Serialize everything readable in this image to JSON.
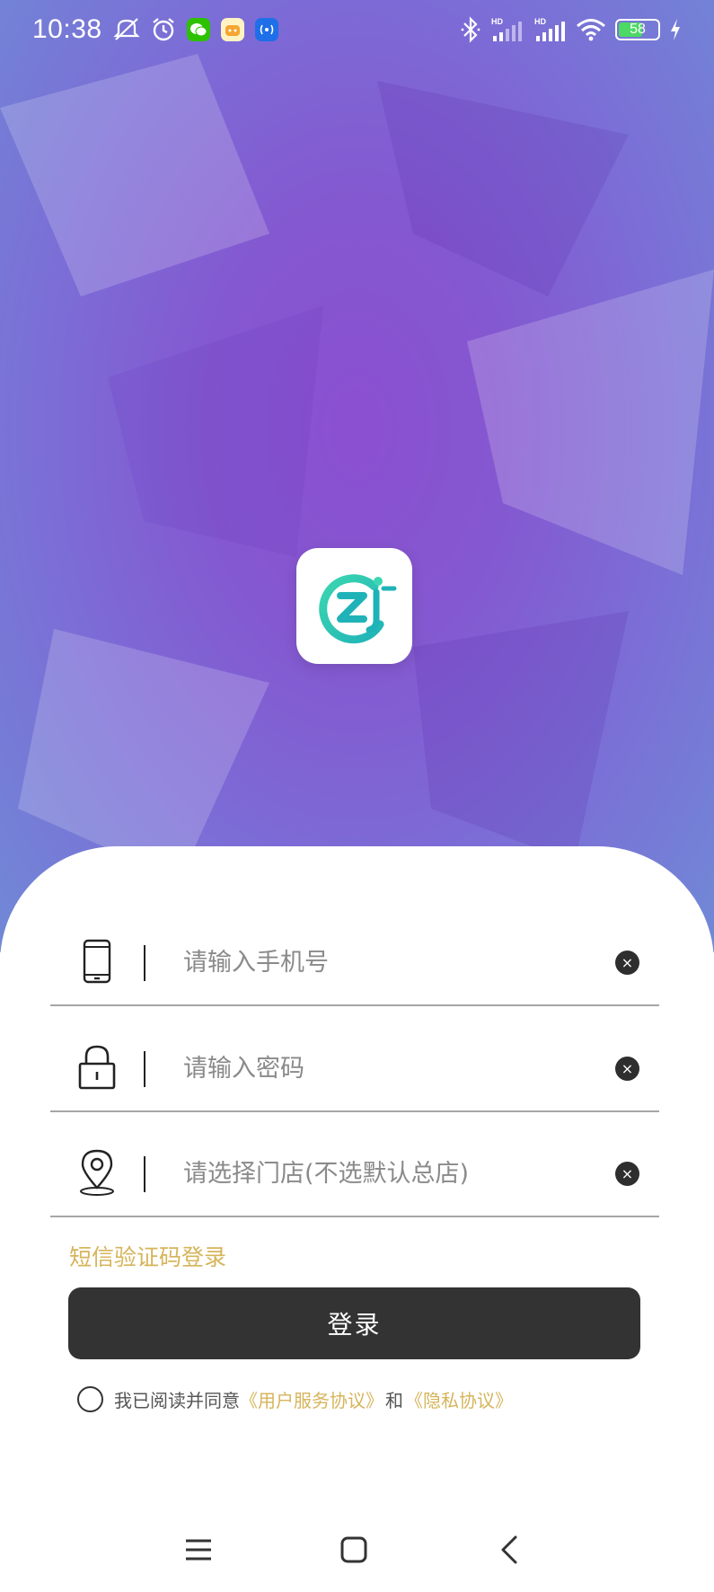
{
  "status_bar": {
    "time": "10:38",
    "battery": "58",
    "left_icons": [
      "mute-icon",
      "alarm-icon",
      "wechat-icon",
      "app-icon",
      "cast-icon"
    ],
    "right_icons": [
      "bluetooth-icon",
      "signal-hd-icon",
      "signal-hd-icon",
      "wifi-icon",
      "battery-icon",
      "charging-icon"
    ]
  },
  "logo": {
    "text": "zj",
    "alt": "app-logo"
  },
  "form": {
    "phone": {
      "placeholder": "请输入手机号",
      "value": ""
    },
    "password": {
      "placeholder": "请输入密码",
      "value": ""
    },
    "store": {
      "placeholder": "请选择门店(不选默认总店)",
      "value": ""
    }
  },
  "sms_login_label": "短信验证码登录",
  "login_button_label": "登录",
  "agreement": {
    "prefix": "我已阅读并同意",
    "user_agreement": "《用户服务协议》",
    "conjunction": "和",
    "privacy_agreement": "《隐私协议》"
  },
  "colors": {
    "accent": "#d6b45a",
    "button": "#333333",
    "background_top": "#8b4fd1"
  }
}
